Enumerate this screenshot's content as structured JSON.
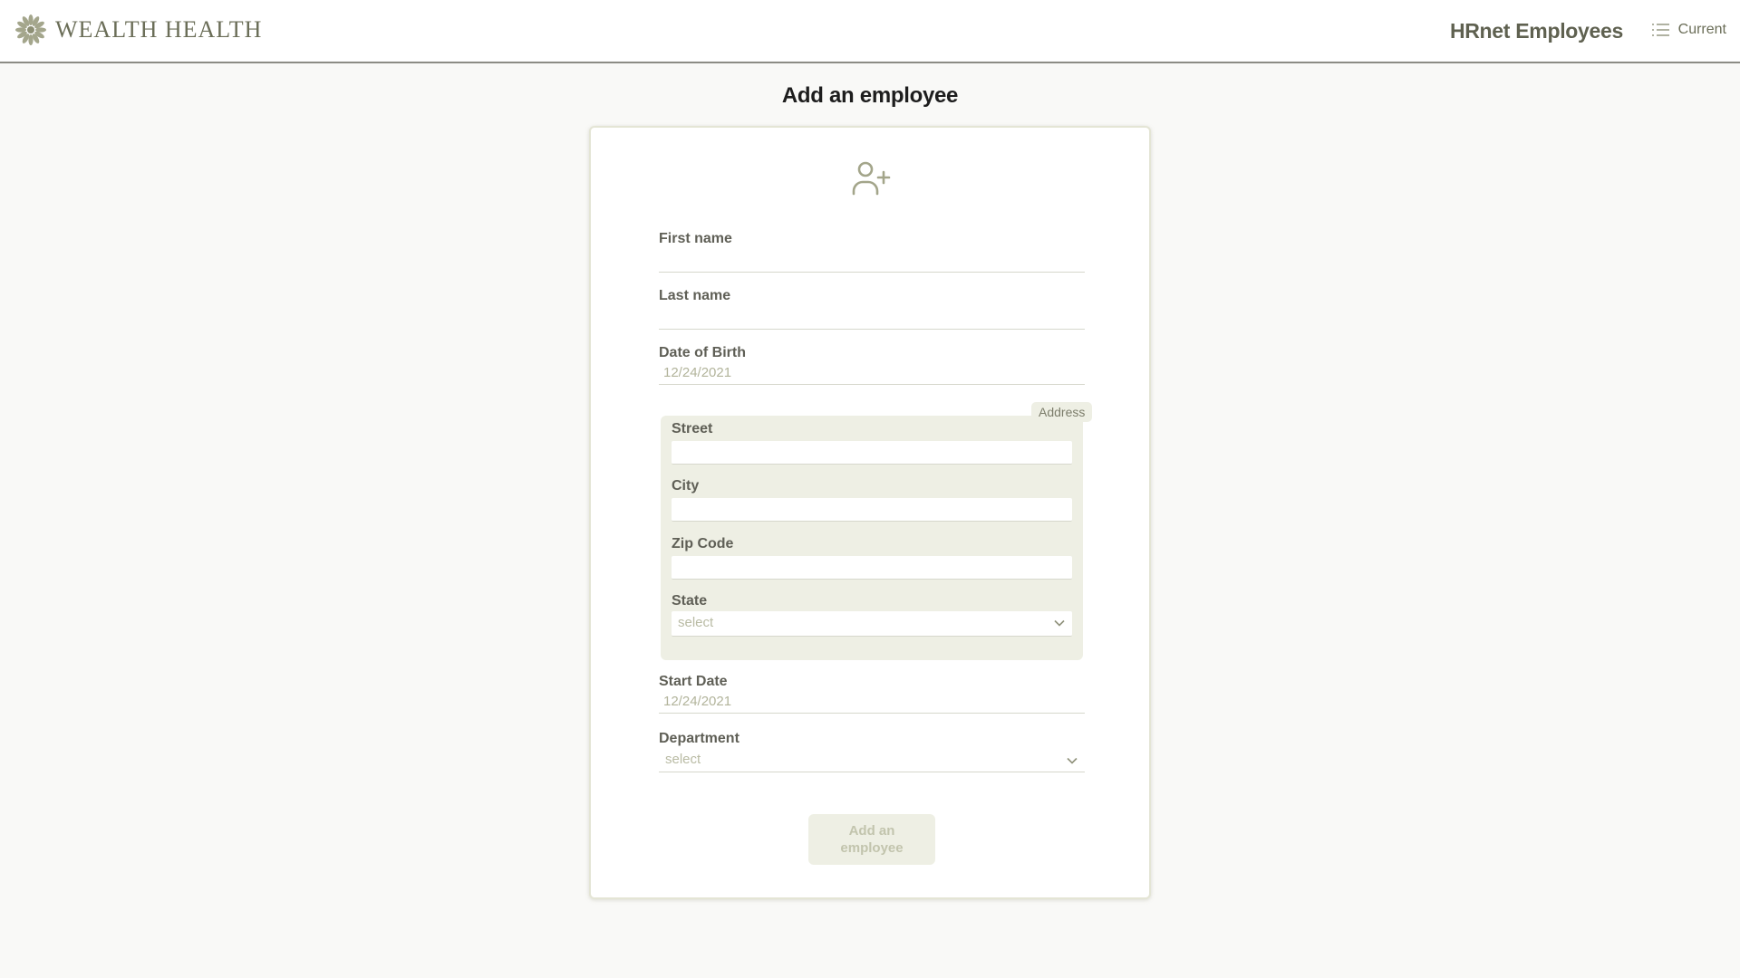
{
  "header": {
    "logo_text": "WEALTH HEALTH",
    "app_title": "HRnet Employees",
    "nav_current_label": "Current",
    "logo_icon": "flower-logo-icon",
    "nav_icon": "list-icon"
  },
  "page": {
    "title": "Add an employee"
  },
  "form": {
    "icon": "user-plus-icon",
    "first_name": {
      "label": "First name",
      "value": ""
    },
    "last_name": {
      "label": "Last name",
      "value": ""
    },
    "date_of_birth": {
      "label": "Date of Birth",
      "value": "12/24/2021"
    },
    "address": {
      "legend": "Address",
      "street": {
        "label": "Street",
        "value": ""
      },
      "city": {
        "label": "City",
        "value": ""
      },
      "zip_code": {
        "label": "Zip Code",
        "value": ""
      },
      "state": {
        "label": "State",
        "selected": "select"
      }
    },
    "start_date": {
      "label": "Start Date",
      "value": "12/24/2021"
    },
    "department": {
      "label": "Department",
      "selected": "select"
    },
    "submit_label": "Add an employee"
  },
  "colors": {
    "accent": "#6b6e58",
    "field_label": "#5f5f56",
    "address_bg": "#eeefe4",
    "page_bg": "#f9f9f7"
  }
}
